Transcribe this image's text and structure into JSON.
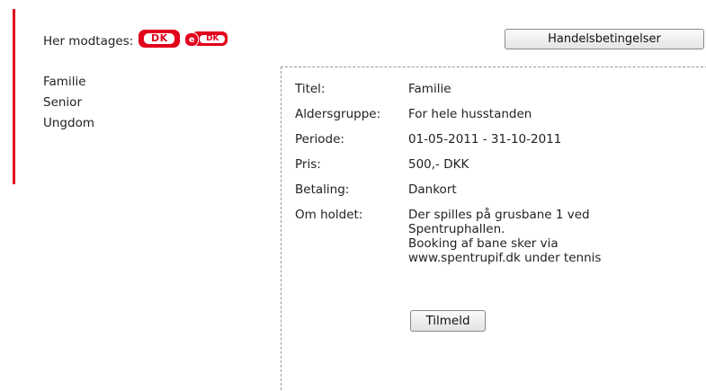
{
  "payment": {
    "label": "Her modtages:",
    "logos": [
      {
        "name": "dankort-logo",
        "text": "DK"
      },
      {
        "name": "edankort-logo",
        "prefix": "e",
        "text": "DK"
      }
    ],
    "brand_color": "#e3001b"
  },
  "terms_button": {
    "label": "Handelsbetingelser"
  },
  "categories": [
    "Familie",
    "Senior",
    "Ungdom"
  ],
  "details": {
    "rows": [
      {
        "key": "Titel:",
        "value": "Familie"
      },
      {
        "key": "Aldersgruppe:",
        "value": "For hele husstanden"
      },
      {
        "key": "Periode:",
        "value": "01-05-2011 - 31-10-2011"
      },
      {
        "key": "Pris:",
        "value": "500,- DKK"
      },
      {
        "key": "Betaling:",
        "value": "Dankort"
      }
    ],
    "description": {
      "key": "Om holdet:",
      "lines": [
        "Der spilles på grusbane 1 ved",
        "Spentruphallen.",
        "Booking af bane sker via",
        "www.spentrupif.dk under tennis"
      ]
    },
    "signup_button": "Tilmeld"
  }
}
